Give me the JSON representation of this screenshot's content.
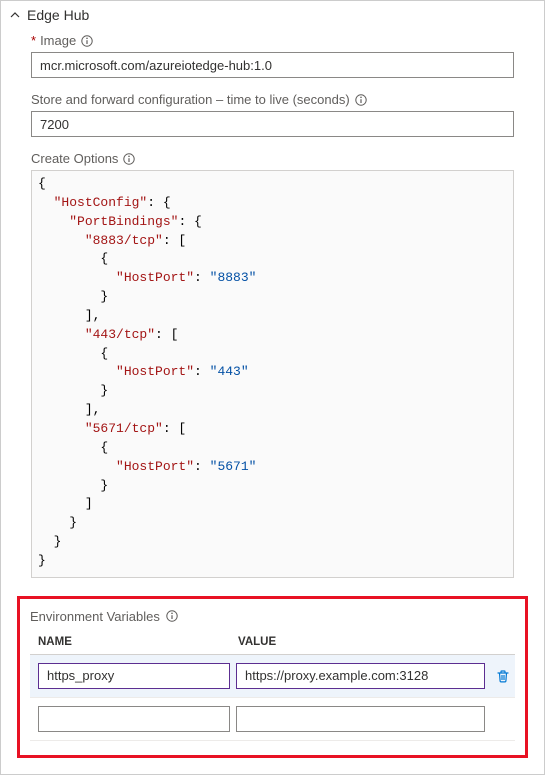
{
  "header": {
    "title": "Edge Hub"
  },
  "image_field": {
    "label": "Image",
    "value": "mcr.microsoft.com/azureiotedge-hub:1.0"
  },
  "ttl_field": {
    "label": "Store and forward configuration – time to live (seconds)",
    "value": "7200"
  },
  "create_options": {
    "label": "Create Options",
    "json": {
      "HostConfig": {
        "PortBindings": {
          "8883/tcp": [
            {
              "HostPort": "8883"
            }
          ],
          "443/tcp": [
            {
              "HostPort": "443"
            }
          ],
          "5671/tcp": [
            {
              "HostPort": "5671"
            }
          ]
        }
      }
    }
  },
  "env_vars": {
    "label": "Environment Variables",
    "columns": {
      "name": "NAME",
      "value": "VALUE"
    },
    "rows": [
      {
        "name": "https_proxy",
        "value": "https://proxy.example.com:3128"
      },
      {
        "name": "",
        "value": ""
      }
    ]
  }
}
